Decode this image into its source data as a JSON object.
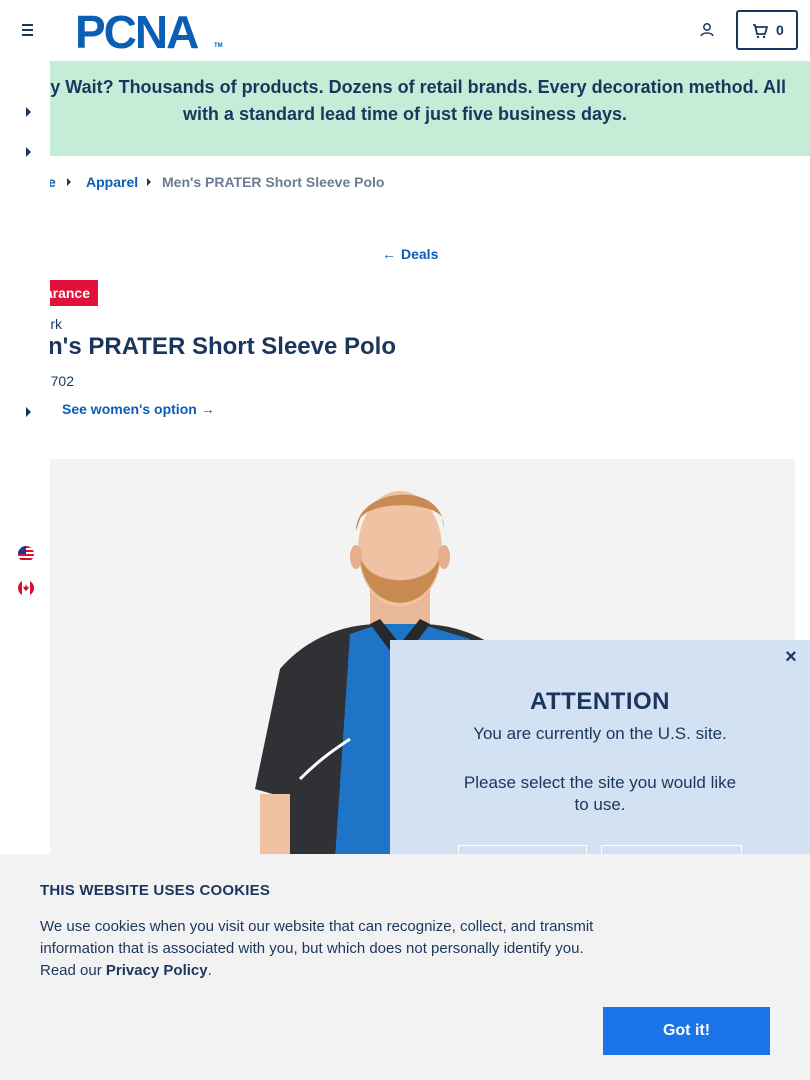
{
  "header": {
    "logo_text": "PCNA",
    "logo_tm": "TM",
    "cart_count": "0"
  },
  "banner": {
    "line1": "y Wait? Thousands of products. Dozens of retail brands. Every decoration method. All",
    "line2": "with a standard lead time of just five business days."
  },
  "breadcrumb": {
    "items": [
      "e",
      "Apparel"
    ],
    "current": "Men's PRATER Short Sleeve Polo"
  },
  "back_link": {
    "label": "Deals",
    "arrow": "←"
  },
  "product": {
    "badge": "arance",
    "brand": "rk",
    "title": "n's PRATER Short Sleeve Polo",
    "sku": "702",
    "womens_link": "See women's option",
    "womens_arrow": "→"
  },
  "attention": {
    "close": "×",
    "title": "ATTENTION",
    "message": "You are currently on the U.S. site.",
    "message2": "Please select the site you would like to use."
  },
  "cookie": {
    "title": "THIS WEBSITE USES COOKIES",
    "text": "We use cookies when you visit our website that can recognize, collect, and transmit information that is associated with you, but which does not personally identify you. Read our ",
    "link": "Privacy Policy",
    "after": ".",
    "button": "Got it!"
  },
  "colors": {
    "navy": "#1b365d",
    "brand_blue": "#0a5fb4",
    "banner_green": "#c5ecd7",
    "badge_red": "#e0113b",
    "modal_blue": "#d3e2f3",
    "button_blue": "#1a73e8"
  },
  "icons": [
    "hamburger-icon",
    "user-icon",
    "cart-icon",
    "us-flag-icon",
    "canada-flag-icon",
    "close-icon"
  ]
}
